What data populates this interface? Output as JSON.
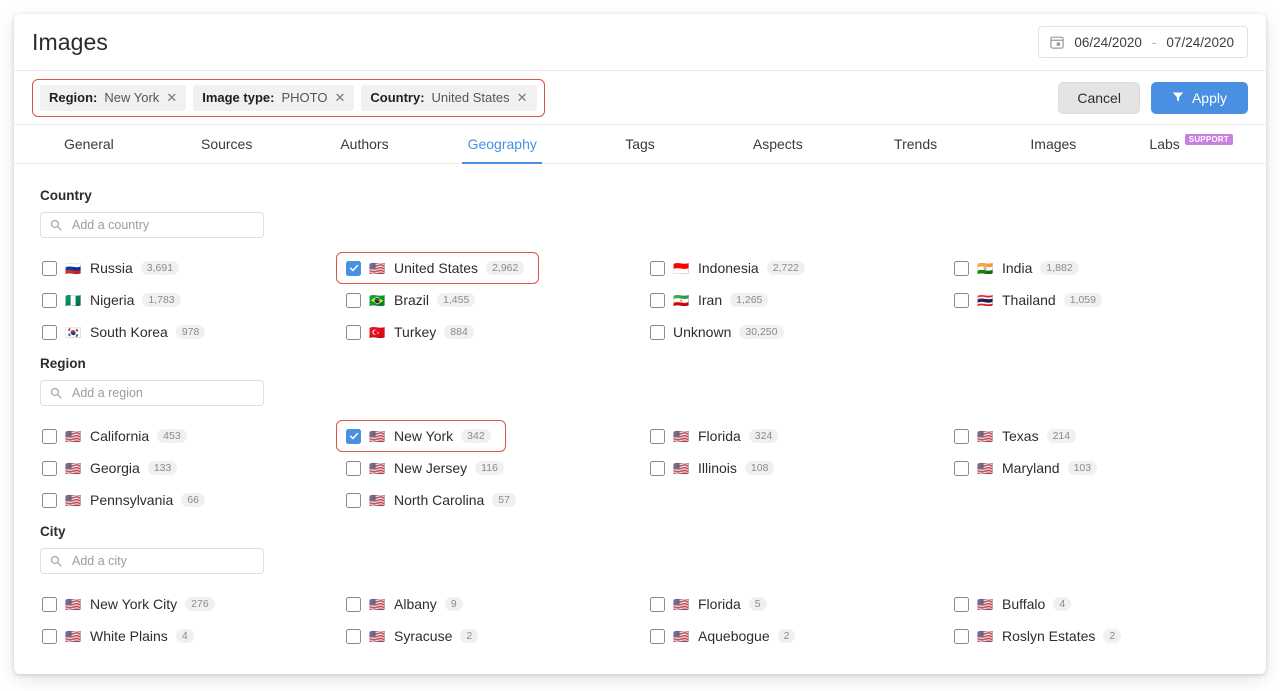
{
  "header": {
    "title": "Images",
    "date_range": {
      "start": "06/24/2020",
      "separator": "-",
      "end": "07/24/2020",
      "icon": "calendar-icon"
    }
  },
  "filter_bar": {
    "chips": [
      {
        "key": "Region:",
        "value": "New York",
        "remove_icon": "close-icon"
      },
      {
        "key": "Image type:",
        "value": "PHOTO",
        "remove_icon": "close-icon"
      },
      {
        "key": "Country:",
        "value": "United States",
        "remove_icon": "close-icon"
      }
    ],
    "cancel_label": "Cancel",
    "apply_label": "Apply",
    "apply_icon": "filter-icon",
    "accent_border": "#d9534f",
    "apply_color": "#4a90e2"
  },
  "tabs": [
    {
      "label": "General",
      "active": false
    },
    {
      "label": "Sources",
      "active": false
    },
    {
      "label": "Authors",
      "active": false
    },
    {
      "label": "Geography",
      "active": true
    },
    {
      "label": "Tags",
      "active": false
    },
    {
      "label": "Aspects",
      "active": false
    },
    {
      "label": "Trends",
      "active": false
    },
    {
      "label": "Images",
      "active": false
    },
    {
      "label": "Labs",
      "active": false,
      "badge": "SUPPORT"
    }
  ],
  "sections": [
    {
      "id": "country",
      "title": "Country",
      "search_placeholder": "Add a country",
      "search_value": "",
      "columns": [
        [
          {
            "flag": "🇷🇺",
            "label": "Russia",
            "count": "3,691",
            "checked": false,
            "highlight": false
          },
          {
            "flag": "🇳🇬",
            "label": "Nigeria",
            "count": "1,783",
            "checked": false,
            "highlight": false
          },
          {
            "flag": "🇰🇷",
            "label": "South Korea",
            "count": "978",
            "checked": false,
            "highlight": false
          }
        ],
        [
          {
            "flag": "🇺🇸",
            "label": "United States",
            "count": "2,962",
            "checked": true,
            "highlight": true
          },
          {
            "flag": "🇧🇷",
            "label": "Brazil",
            "count": "1,455",
            "checked": false,
            "highlight": false
          },
          {
            "flag": "🇹🇷",
            "label": "Turkey",
            "count": "884",
            "checked": false,
            "highlight": false
          }
        ],
        [
          {
            "flag": "🇮🇩",
            "label": "Indonesia",
            "count": "2,722",
            "checked": false,
            "highlight": false
          },
          {
            "flag": "🇮🇷",
            "label": "Iran",
            "count": "1,265",
            "checked": false,
            "highlight": false
          },
          {
            "flag": "",
            "label": "Unknown",
            "count": "30,250",
            "checked": false,
            "highlight": false
          }
        ],
        [
          {
            "flag": "🇮🇳",
            "label": "India",
            "count": "1,882",
            "checked": false,
            "highlight": false
          },
          {
            "flag": "🇹🇭",
            "label": "Thailand",
            "count": "1,059",
            "checked": false,
            "highlight": false
          }
        ]
      ]
    },
    {
      "id": "region",
      "title": "Region",
      "search_placeholder": "Add a region",
      "search_value": "",
      "columns": [
        [
          {
            "flag": "🇺🇸",
            "label": "California",
            "count": "453",
            "checked": false,
            "highlight": false
          },
          {
            "flag": "🇺🇸",
            "label": "Georgia",
            "count": "133",
            "checked": false,
            "highlight": false
          },
          {
            "flag": "🇺🇸",
            "label": "Pennsylvania",
            "count": "66",
            "checked": false,
            "highlight": false
          }
        ],
        [
          {
            "flag": "🇺🇸",
            "label": "New York",
            "count": "342",
            "checked": true,
            "highlight": true
          },
          {
            "flag": "🇺🇸",
            "label": "New Jersey",
            "count": "116",
            "checked": false,
            "highlight": false
          },
          {
            "flag": "🇺🇸",
            "label": "North Carolina",
            "count": "57",
            "checked": false,
            "highlight": false
          }
        ],
        [
          {
            "flag": "🇺🇸",
            "label": "Florida",
            "count": "324",
            "checked": false,
            "highlight": false
          },
          {
            "flag": "🇺🇸",
            "label": "Illinois",
            "count": "108",
            "checked": false,
            "highlight": false
          }
        ],
        [
          {
            "flag": "🇺🇸",
            "label": "Texas",
            "count": "214",
            "checked": false,
            "highlight": false
          },
          {
            "flag": "🇺🇸",
            "label": "Maryland",
            "count": "103",
            "checked": false,
            "highlight": false
          }
        ]
      ]
    },
    {
      "id": "city",
      "title": "City",
      "search_placeholder": "Add a city",
      "search_value": "",
      "columns": [
        [
          {
            "flag": "🇺🇸",
            "label": "New York City",
            "count": "276",
            "checked": false,
            "highlight": false
          },
          {
            "flag": "🇺🇸",
            "label": "White Plains",
            "count": "4",
            "checked": false,
            "highlight": false
          }
        ],
        [
          {
            "flag": "🇺🇸",
            "label": "Albany",
            "count": "9",
            "checked": false,
            "highlight": false
          },
          {
            "flag": "🇺🇸",
            "label": "Syracuse",
            "count": "2",
            "checked": false,
            "highlight": false
          }
        ],
        [
          {
            "flag": "🇺🇸",
            "label": "Florida",
            "count": "5",
            "checked": false,
            "highlight": false
          },
          {
            "flag": "🇺🇸",
            "label": "Aquebogue",
            "count": "2",
            "checked": false,
            "highlight": false
          }
        ],
        [
          {
            "flag": "🇺🇸",
            "label": "Buffalo",
            "count": "4",
            "checked": false,
            "highlight": false
          },
          {
            "flag": "🇺🇸",
            "label": "Roslyn Estates",
            "count": "2",
            "checked": false,
            "highlight": false
          }
        ]
      ]
    }
  ],
  "icons": {
    "search": "search-icon"
  }
}
